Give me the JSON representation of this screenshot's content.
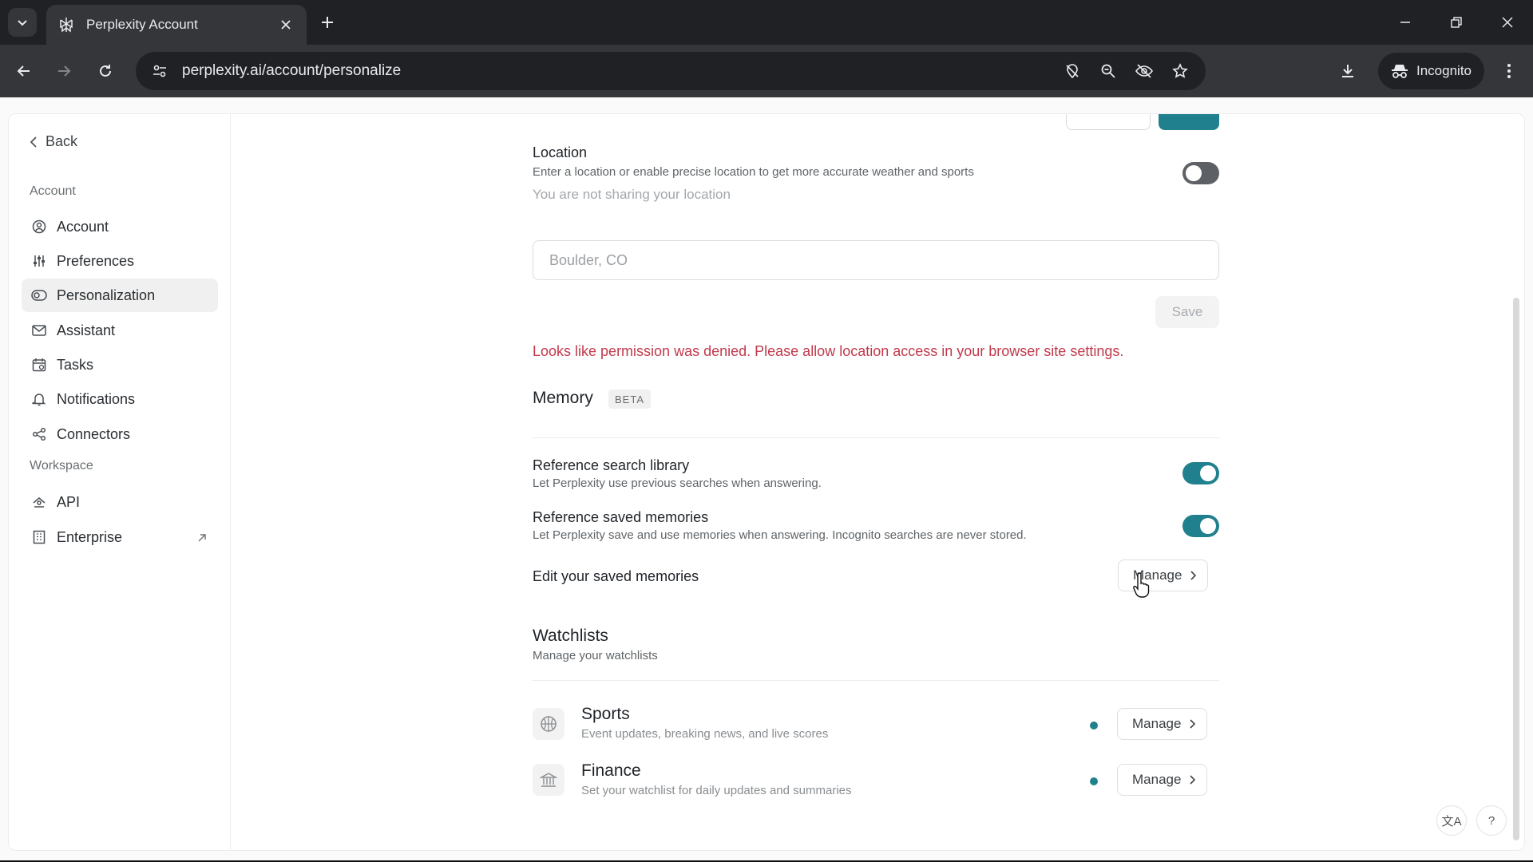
{
  "browser": {
    "tab_title": "Perplexity Account",
    "url": "perplexity.ai/account/personalize",
    "incognito_label": "Incognito"
  },
  "sidebar": {
    "back_label": "Back",
    "account_section": "Account",
    "workspace_section": "Workspace",
    "items": [
      {
        "label": "Account",
        "icon": "user-circle-icon"
      },
      {
        "label": "Preferences",
        "icon": "sliders-icon"
      },
      {
        "label": "Personalization",
        "icon": "toggle-icon",
        "active": true
      },
      {
        "label": "Assistant",
        "icon": "mail-icon"
      },
      {
        "label": "Tasks",
        "icon": "calendar-icon"
      },
      {
        "label": "Notifications",
        "icon": "bell-icon"
      },
      {
        "label": "Connectors",
        "icon": "share-icon"
      }
    ],
    "workspace_items": [
      {
        "label": "API",
        "icon": "api-icon"
      },
      {
        "label": "Enterprise",
        "icon": "building-icon"
      }
    ]
  },
  "location": {
    "title": "Location",
    "description": "Enter a location or enable precise location to get more accurate weather and sports",
    "status": "You are not sharing your location",
    "toggle_on": false,
    "input_placeholder": "Boulder, CO",
    "save_label": "Save",
    "error": "Looks like permission was denied. Please allow location access in your browser site settings."
  },
  "memory": {
    "title": "Memory",
    "badge": "BETA",
    "search_library_title": "Reference search library",
    "search_library_desc": "Let Perplexity use previous searches when answering.",
    "search_library_on": true,
    "saved_memories_title": "Reference saved memories",
    "saved_memories_desc": "Let Perplexity save and use memories when answering. Incognito searches are never stored.",
    "saved_memories_on": true,
    "edit_label": "Edit your saved memories",
    "manage_label": "Manage"
  },
  "watchlists": {
    "title": "Watchlists",
    "subtitle": "Manage your watchlists",
    "items": [
      {
        "title": "Sports",
        "desc": "Event updates, breaking news, and live scores",
        "manage": "Manage"
      },
      {
        "title": "Finance",
        "desc": "Set your watchlist for daily updates and summaries",
        "manage": "Manage"
      }
    ]
  },
  "help": {
    "translate_glyph": "文A",
    "help_glyph": "?"
  },
  "colors": {
    "accent": "#20808d",
    "error": "#c0394b"
  }
}
